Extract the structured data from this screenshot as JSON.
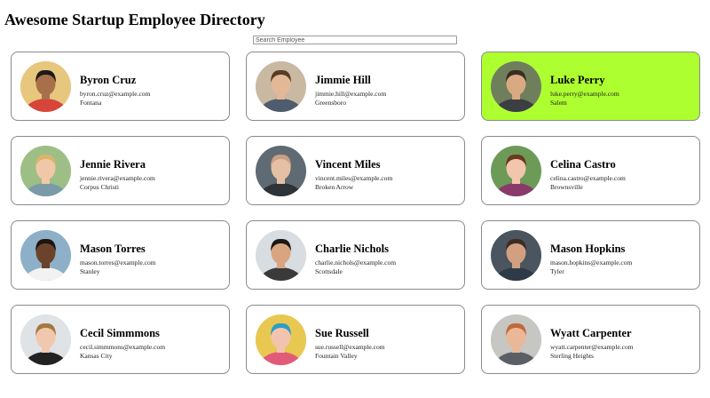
{
  "header": {
    "title": "Awesome Startup Employee Directory"
  },
  "search": {
    "placeholder": "Search Employee",
    "value": ""
  },
  "employees": [
    {
      "name": "Byron Cruz",
      "email": "byron.cruz@example.com",
      "city": "Fontana",
      "selected": false,
      "photo": {
        "bg": "#e7c77e",
        "skin": "#a8704a",
        "hair": "#1e1a18",
        "shirt": "#d6453a"
      }
    },
    {
      "name": "Jimmie Hill",
      "email": "jimmie.hill@example.com",
      "city": "Greensboro",
      "selected": false,
      "photo": {
        "bg": "#c9b8a2",
        "skin": "#e3b896",
        "hair": "#5a3b24",
        "shirt": "#4e5c6e"
      }
    },
    {
      "name": "Luke Perry",
      "email": "luke.perry@example.com",
      "city": "Salem",
      "selected": true,
      "photo": {
        "bg": "#6f7f5c",
        "skin": "#d9a982",
        "hair": "#3a2c22",
        "shirt": "#3b3f44"
      }
    },
    {
      "name": "Jennie Rivera",
      "email": "jennie.rivera@example.com",
      "city": "Corpus Christi",
      "selected": false,
      "photo": {
        "bg": "#9dbf86",
        "skin": "#f0c8a8",
        "hair": "#d9b46a",
        "shirt": "#7a9aa8"
      }
    },
    {
      "name": "Vincent Miles",
      "email": "vincent.miles@example.com",
      "city": "Broken Arrow",
      "selected": false,
      "photo": {
        "bg": "#5f6a72",
        "skin": "#e5c0a4",
        "hair": "#c99f84",
        "shirt": "#2e3338"
      }
    },
    {
      "name": "Celina Castro",
      "email": "celina.castro@example.com",
      "city": "Brownsville",
      "selected": false,
      "photo": {
        "bg": "#6e9a58",
        "skin": "#f2c6ac",
        "hair": "#6a3a20",
        "shirt": "#8a3a6a"
      }
    },
    {
      "name": "Mason Torres",
      "email": "mason.torres@example.com",
      "city": "Stanley",
      "selected": false,
      "photo": {
        "bg": "#8db0c8",
        "skin": "#6b432c",
        "hair": "#1e1410",
        "shirt": "#f2f2f2"
      }
    },
    {
      "name": "Charlie Nichols",
      "email": "charlie.nichols@example.com",
      "city": "Scottsdale",
      "selected": false,
      "photo": {
        "bg": "#d8dde2",
        "skin": "#d9a580",
        "hair": "#1c1816",
        "shirt": "#3a3a3a"
      }
    },
    {
      "name": "Mason Hopkins",
      "email": "mason.hopkins@example.com",
      "city": "Tyler",
      "selected": false,
      "photo": {
        "bg": "#4a5560",
        "skin": "#d2a080",
        "hair": "#3e2c22",
        "shirt": "#2f3a48"
      }
    },
    {
      "name": "Cecil Simmmons",
      "email": "cecil.simmmons@example.com",
      "city": "Kansas City",
      "selected": false,
      "photo": {
        "bg": "#dfe3e6",
        "skin": "#f0c8ae",
        "hair": "#a4783e",
        "shirt": "#222222"
      }
    },
    {
      "name": "Sue Russell",
      "email": "sue.russell@example.com",
      "city": "Fountain Valley",
      "selected": false,
      "photo": {
        "bg": "#e8c850",
        "skin": "#f2c4b0",
        "hair": "#2a9ec8",
        "shirt": "#e25a7a"
      }
    },
    {
      "name": "Wyatt Carpenter",
      "email": "wyatt.carpenter@example.com",
      "city": "Sterling Heights",
      "selected": false,
      "photo": {
        "bg": "#c6c6c2",
        "skin": "#eab898",
        "hair": "#c06a3a",
        "shirt": "#5a5f66"
      }
    }
  ],
  "colors": {
    "selected_card_bg": "#adff2f",
    "card_border": "#8a8a8a"
  }
}
